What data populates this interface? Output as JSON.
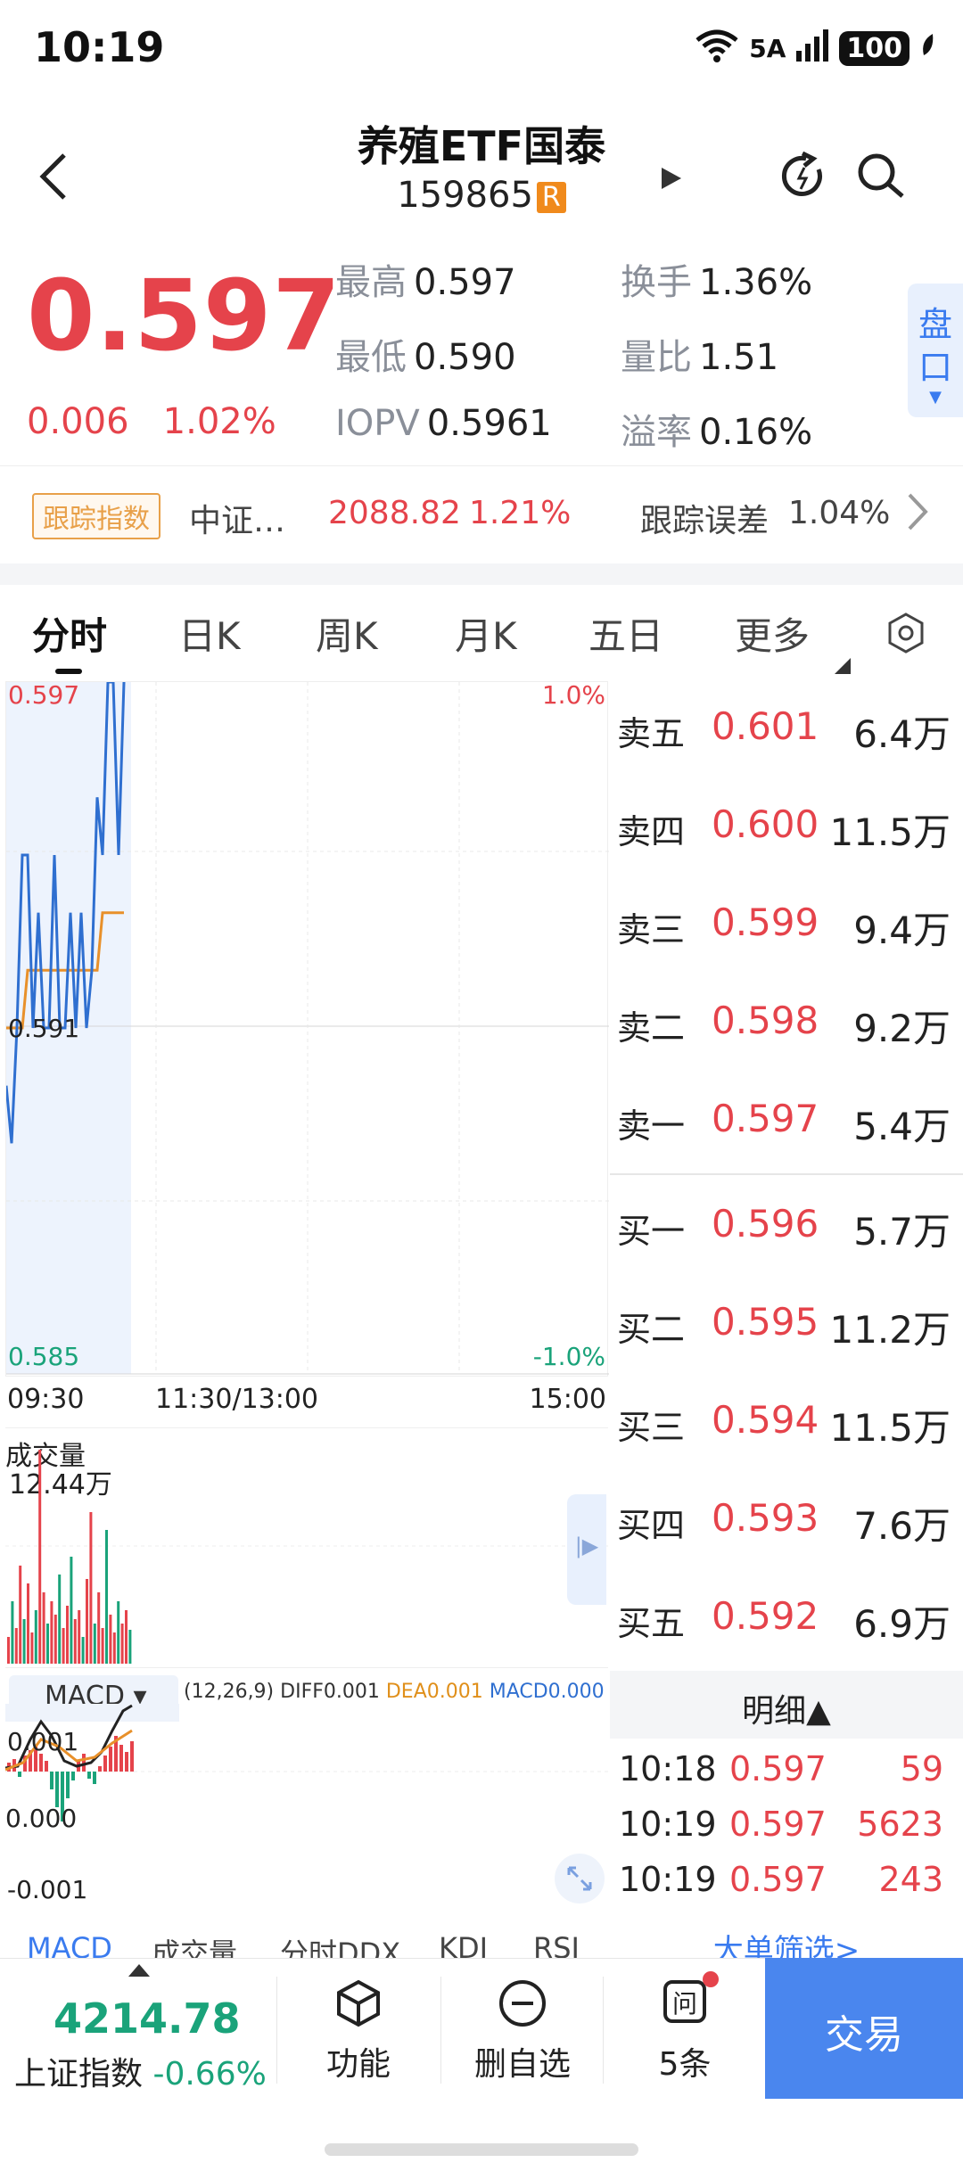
{
  "status": {
    "time": "10:19",
    "network": "5A",
    "battery": "100"
  },
  "header": {
    "title": "养殖ETF国泰",
    "code": "159865",
    "badge": "R"
  },
  "quote": {
    "price": "0.597",
    "change": "0.006",
    "change_pct": "1.02%",
    "high_label": "最高",
    "high": "0.597",
    "low_label": "最低",
    "low": "0.590",
    "iopv_label": "IOPV",
    "iopv": "0.5961",
    "turnover_label": "换手",
    "turnover": "1.36%",
    "volratio_label": "量比",
    "volratio": "1.51",
    "premium_label": "溢率",
    "premium": "0.16%",
    "pankou": "盘口"
  },
  "tracking": {
    "tag": "跟踪指数",
    "index_name": "中证…",
    "index_value": "2088.82",
    "index_pct": "1.21%",
    "error_label": "跟踪误差",
    "error_value": "1.04%"
  },
  "tabs": [
    "分时",
    "日K",
    "周K",
    "月K",
    "五日",
    "更多"
  ],
  "chart": {
    "y_top": "0.597",
    "y_mid": "0.591",
    "y_bottom": "0.585",
    "pct_top": "1.0%",
    "pct_bottom": "-1.0%",
    "t_start": "09:30",
    "t_mid": "11:30/13:00",
    "t_end": "15:00",
    "vol_label": "成交量",
    "vol_value": "12.44万",
    "macd_select": "MACD",
    "macd_params": "(12,26,9)",
    "diff": "DIFF0.001",
    "dea": "DEA0.001",
    "macd": "MACD0.000",
    "macd_top": "0.001",
    "macd_mid": "0.000",
    "macd_bottom": "-0.001",
    "price_line": [
      0.59,
      0.589,
      0.591,
      0.594,
      0.594,
      0.591,
      0.593,
      0.591,
      0.591,
      0.594,
      0.591,
      0.591,
      0.593,
      0.591,
      0.593,
      0.591,
      0.592,
      0.595,
      0.594,
      0.597,
      0.597,
      0.594,
      0.597
    ],
    "avg_line": [
      0.591,
      0.591,
      0.591,
      0.591,
      0.592,
      0.592,
      0.592,
      0.592,
      0.592,
      0.592,
      0.592,
      0.592,
      0.592,
      0.592,
      0.592,
      0.592,
      0.592,
      0.592,
      0.593,
      0.593,
      0.593,
      0.593,
      0.593
    ]
  },
  "orderbook": {
    "asks": [
      {
        "label": "卖五",
        "price": "0.601",
        "vol": "6.4万"
      },
      {
        "label": "卖四",
        "price": "0.600",
        "vol": "11.5万"
      },
      {
        "label": "卖三",
        "price": "0.599",
        "vol": "9.4万"
      },
      {
        "label": "卖二",
        "price": "0.598",
        "vol": "9.2万"
      },
      {
        "label": "卖一",
        "price": "0.597",
        "vol": "5.4万"
      }
    ],
    "bids": [
      {
        "label": "买一",
        "price": "0.596",
        "vol": "5.7万"
      },
      {
        "label": "买二",
        "price": "0.595",
        "vol": "11.2万"
      },
      {
        "label": "买三",
        "price": "0.594",
        "vol": "11.5万"
      },
      {
        "label": "买四",
        "price": "0.593",
        "vol": "7.6万"
      },
      {
        "label": "买五",
        "price": "0.592",
        "vol": "6.9万"
      }
    ]
  },
  "ticks": {
    "header": "明细▲",
    "rows": [
      {
        "time": "10:18",
        "price": "0.597",
        "vol": "59"
      },
      {
        "time": "10:19",
        "price": "0.597",
        "vol": "5623"
      },
      {
        "time": "10:19",
        "price": "0.597",
        "vol": "243"
      }
    ],
    "big_order": "大单筛选>"
  },
  "indicator_tabs": [
    "MACD",
    "成交量",
    "分时DDX",
    "KDJ",
    "RSI"
  ],
  "bottom": {
    "index_value": "4214.78",
    "index_name": "上证指数",
    "index_pct": "-0.66%",
    "func": "功能",
    "remove": "删自选",
    "ask_count": "5条",
    "trade": "交易"
  }
}
